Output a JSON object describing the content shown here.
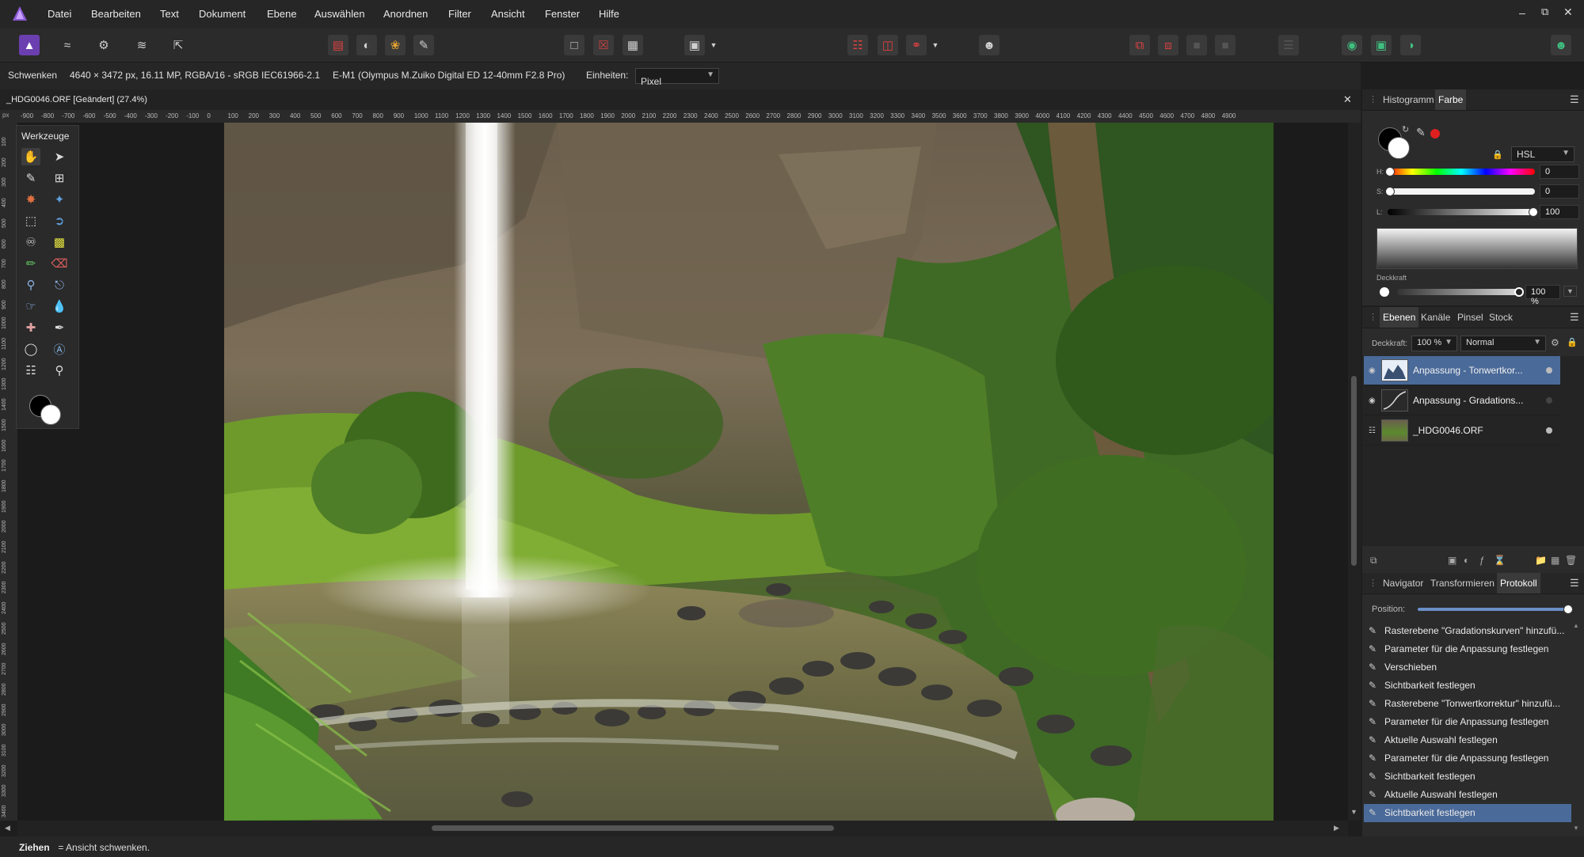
{
  "menu": [
    "Datei",
    "Bearbeiten",
    "Text",
    "Dokument",
    "Ebene",
    "Auswählen",
    "Anordnen",
    "Filter",
    "Ansicht",
    "Fenster",
    "Hilfe"
  ],
  "context": {
    "tool": "Schwenken",
    "info": "4640 × 3472 px, 16.11 MP, RGBA/16 - sRGB IEC61966-2.1",
    "camera": "E-M1 (Olympus M.Zuiko Digital ED 12-40mm F2.8 Pro)",
    "units_label": "Einheiten:",
    "units_value": "Pixel"
  },
  "document": {
    "tab_title": "_HDG0046.ORF [Geändert] (27.4%)",
    "close_icon": "close-icon"
  },
  "ruler": {
    "unit": "px",
    "top_ticks": [
      "-900",
      "-800",
      "-700",
      "-600",
      "-500",
      "-400",
      "-300",
      "-200",
      "-100",
      "0",
      "100",
      "200",
      "300",
      "400",
      "500",
      "600",
      "700",
      "800",
      "900",
      "1000",
      "1100",
      "1200",
      "1300",
      "1400",
      "1500",
      "1600",
      "1700",
      "1800",
      "1900",
      "2000",
      "2100",
      "2200",
      "2300",
      "2400",
      "2500",
      "2600",
      "2700",
      "2800",
      "2900",
      "3000",
      "3100",
      "3200",
      "3300",
      "3400",
      "3500",
      "3600",
      "3700",
      "3800",
      "3900",
      "4000",
      "4100",
      "4200",
      "4300",
      "4400",
      "4500",
      "4600",
      "4700",
      "4800",
      "4900"
    ],
    "left_ticks": [
      "100",
      "200",
      "300",
      "400",
      "500",
      "600",
      "700",
      "800",
      "900",
      "1000",
      "1100",
      "1200",
      "1300",
      "1400",
      "1500",
      "1600",
      "1700",
      "1800",
      "1900",
      "2000",
      "2100",
      "2200",
      "2300",
      "2400",
      "2500",
      "2600",
      "2700",
      "2800",
      "2900",
      "3000",
      "3100",
      "3200",
      "3300",
      "3400"
    ]
  },
  "tools_panel": {
    "title": "Werkzeuge"
  },
  "color_panel": {
    "tabs": [
      "Histogramm",
      "Farbe"
    ],
    "active_tab": "Farbe",
    "mode": "HSL",
    "h_label": "H:",
    "h_value": "0",
    "s_label": "S:",
    "s_value": "0",
    "l_label": "L:",
    "l_value": "100",
    "opacity_label": "Deckkraft",
    "opacity_value": "100 %"
  },
  "layers_panel": {
    "tabs": [
      "Ebenen",
      "Kanäle",
      "Pinsel",
      "Stock"
    ],
    "active_tab": "Ebenen",
    "opacity_label": "Deckkraft:",
    "opacity_value": "100 %",
    "blend_mode": "Normal",
    "layers": [
      {
        "name": "Anpassung - Tonwertkor...",
        "selected": true
      },
      {
        "name": "Anpassung - Gradations...",
        "selected": false
      },
      {
        "name": "_HDG0046.ORF",
        "selected": false
      }
    ]
  },
  "history_panel": {
    "tabs": [
      "Navigator",
      "Transformieren",
      "Protokoll"
    ],
    "active_tab": "Protokoll",
    "position_label": "Position:",
    "position_fraction": 1.0,
    "items": [
      "Rasterebene \"Gradationskurven\" hinzufü...",
      "Parameter für die Anpassung festlegen",
      "Verschieben",
      "Sichtbarkeit festlegen",
      "Rasterebene \"Tonwertkorrektur\" hinzufü...",
      "Parameter für die Anpassung festlegen",
      "Aktuelle Auswahl festlegen",
      "Parameter für die Anpassung festlegen",
      "Sichtbarkeit festlegen",
      "Aktuelle Auswahl festlegen",
      "Sichtbarkeit festlegen"
    ],
    "selected_index": 10
  },
  "status": {
    "bold": "Ziehen",
    "rest": " = Ansicht schwenken."
  },
  "colors": {
    "accent": "#4a6a99",
    "app_bg": "#1e1e1e",
    "panel_bg": "#2b2b2b"
  }
}
